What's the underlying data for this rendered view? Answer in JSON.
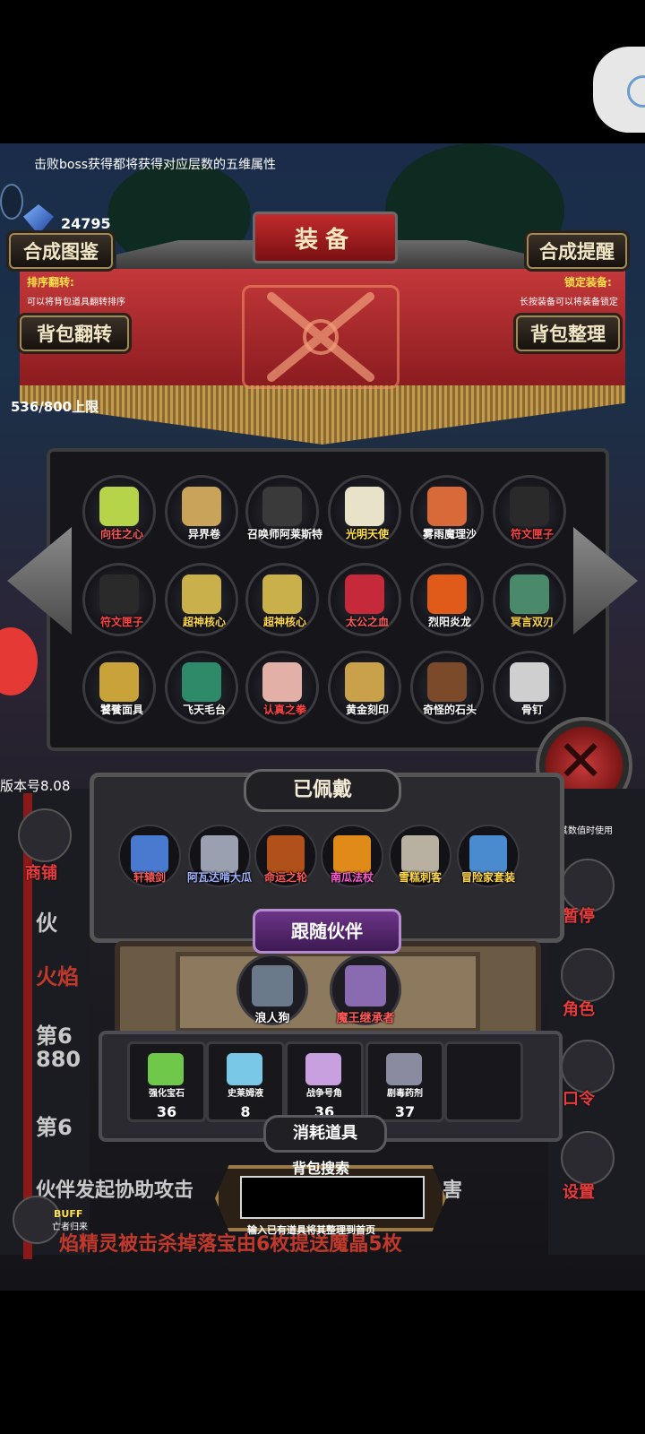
{
  "top_hint": "击败boss获得都将获得对应层数的五维属性",
  "gem_count": "24795",
  "title": "装备",
  "buttons": {
    "synthesis_codex": "合成图鉴",
    "synthesis_reminder": "合成提醒",
    "bag_flip": "背包翻转",
    "bag_sort": "背包整理"
  },
  "sort_flip": {
    "label": "排序翻转:",
    "desc": "可以将背包道具翻转排序"
  },
  "lock_equip": {
    "label": "锁定装备:",
    "desc": "长按装备可以将装备锁定"
  },
  "capacity": "536/800上限",
  "inventory": [
    {
      "label": "向往之心",
      "color": "#ff5a5a",
      "art": "#b6d44a"
    },
    {
      "label": "异界卷",
      "color": "#ffffff",
      "art": "#c9a35a"
    },
    {
      "label": "召唤师阿莱斯特",
      "color": "#ffffff",
      "art": "#3a3a3a"
    },
    {
      "label": "光明天使",
      "color": "#ffe14a",
      "art": "#e8e2c8"
    },
    {
      "label": "雾雨魔理沙",
      "color": "#ffffff",
      "art": "#d86a3a"
    },
    {
      "label": "符文匣子",
      "color": "#ff4545",
      "art": "#2a2a2a"
    },
    {
      "label": "符文匣子",
      "color": "#ff4545",
      "art": "#2a2a2a"
    },
    {
      "label": "超神核心",
      "color": "#ffd84a",
      "art": "#c9b04a"
    },
    {
      "label": "超神核心",
      "color": "#ffd84a",
      "art": "#c9b04a"
    },
    {
      "label": "太公之血",
      "color": "#ff5a5a",
      "art": "#c62a3a"
    },
    {
      "label": "烈阳炎龙",
      "color": "#ffffff",
      "art": "#e05a1a"
    },
    {
      "label": "冥言双刃",
      "color": "#ffd84a",
      "art": "#4a8a6a"
    },
    {
      "label": "饕餮面具",
      "color": "#ffffff",
      "art": "#c9a23a"
    },
    {
      "label": "飞天毛台",
      "color": "#ffffff",
      "art": "#2f8a6a"
    },
    {
      "label": "认真之拳",
      "color": "#ff4545",
      "art": "#e3b0a8"
    },
    {
      "label": "黄金刻印",
      "color": "#ffffff",
      "art": "#c9a14a"
    },
    {
      "label": "奇怪的石头",
      "color": "#ffffff",
      "art": "#7a4a2a"
    },
    {
      "label": "骨钉",
      "color": "#ffffff",
      "art": "#cfcfcf"
    }
  ],
  "version": "版本号8.08",
  "equipped_title": "已佩戴",
  "equipped": [
    {
      "label": "轩辕剑",
      "color": "#ff5a5a",
      "art": "#4a7ad0"
    },
    {
      "label": "阿瓦达啃大瓜",
      "color": "#9fb3ff",
      "art": "#9aa0b0"
    },
    {
      "label": "命运之轮",
      "color": "#ff5a5a",
      "art": "#b0501a"
    },
    {
      "label": "南瓜法杖",
      "color": "#ff5ad0",
      "art": "#e08a1a"
    },
    {
      "label": "雪糕刺客",
      "color": "#ffd84a",
      "art": "#b8b0a0"
    },
    {
      "label": "冒险家套装",
      "color": "#ffd84a",
      "art": "#4a8acf"
    }
  ],
  "companion_title": "跟随伙伴",
  "companions": [
    {
      "label": "浪人狗",
      "color": "#ffffff",
      "art": "#6a7a8a"
    },
    {
      "label": "魔王继承者",
      "color": "#ff5a5a",
      "art": "#8a6ab0"
    }
  ],
  "consumables_title": "消耗道具",
  "consumables": [
    {
      "label": "强化宝石",
      "count": "36",
      "art": "#6fc84a"
    },
    {
      "label": "史莱姆液",
      "count": "8",
      "art": "#7ac8e8"
    },
    {
      "label": "战争号角",
      "count": "36",
      "art": "#c8a0e0"
    },
    {
      "label": "剧毒药剂",
      "count": "37",
      "art": "#8a8aa0"
    }
  ],
  "search": {
    "title": "背包搜索",
    "hint": "输入已有道具将其整理到首页",
    "value": ""
  },
  "side_left": {
    "shop": "商铺",
    "buff": "BUFF",
    "buff_sub": "亡者归来"
  },
  "side_right": {
    "pause": "暂停",
    "role": "角色",
    "code": "口令",
    "settings": "设置",
    "note": "其数值时使用"
  },
  "bg_texts": {
    "t1": "伙",
    "t2": "火焰",
    "t3": "第6",
    "t4": "880",
    "t5": "第6",
    "t6": "伙伴发起协助攻击",
    "t7": "害",
    "t8": "焰精灵被击杀掉落宝由6枚提送魔晶5枚"
  }
}
